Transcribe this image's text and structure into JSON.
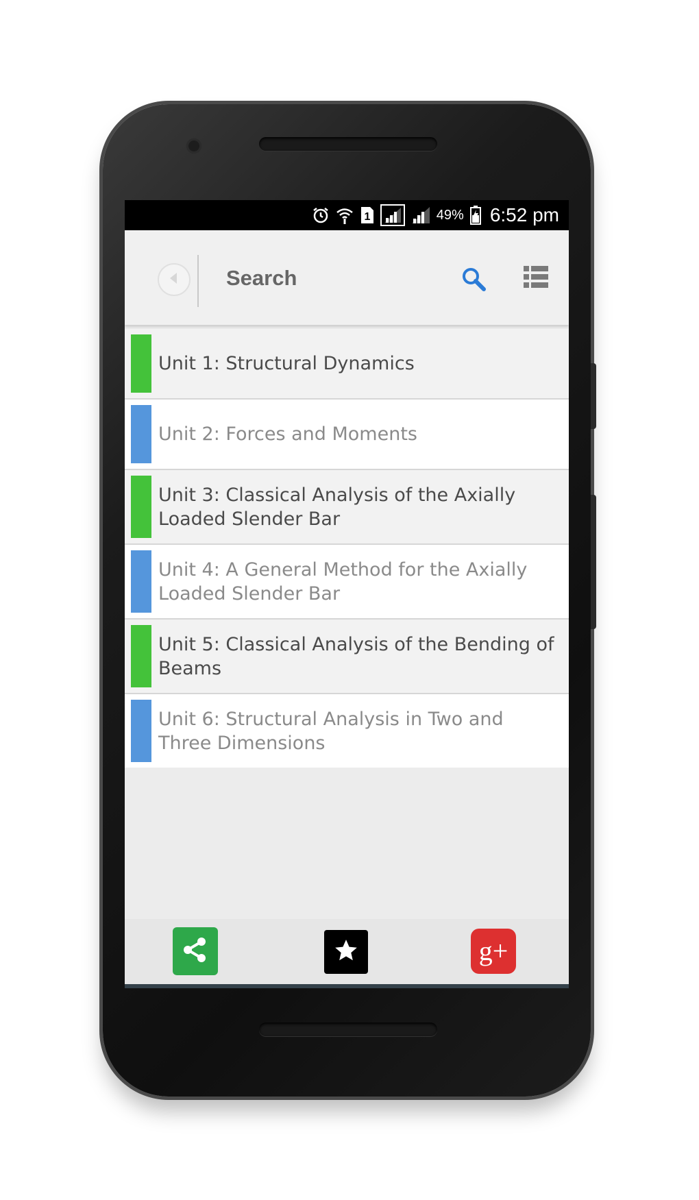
{
  "status_bar": {
    "battery_percent": "49%",
    "time": "6:52 pm",
    "sim_label": "1",
    "icons": [
      "alarm-icon",
      "wifi-icon",
      "sim-icon",
      "signal-icon",
      "signal-icon",
      "battery-icon"
    ]
  },
  "toolbar": {
    "title": "Search",
    "back_icon": "back-arrow-icon",
    "search_icon": "search-icon",
    "menu_icon": "list-menu-icon",
    "search_color": "#2b7bd6"
  },
  "units": [
    {
      "label": "Unit 1: Structural Dynamics",
      "color": "#44c23a"
    },
    {
      "label": "Unit 2: Forces and Moments",
      "color": "#5596dc"
    },
    {
      "label": "Unit 3: Classical Analysis of the Axially Loaded Slender Bar",
      "color": "#44c23a"
    },
    {
      "label": "Unit 4: A General Method for the Axially Loaded Slender Bar",
      "color": "#5596dc"
    },
    {
      "label": "Unit 5: Classical Analysis of the Bending of Beams",
      "color": "#44c23a"
    },
    {
      "label": "Unit 6: Structural Analysis in Two and Three Dimensions",
      "color": "#5596dc"
    }
  ],
  "bottom_bar": {
    "share": {
      "icon": "share-icon",
      "color": "#2ea84a"
    },
    "favorite": {
      "icon": "star-icon",
      "color": "#000000"
    },
    "google_plus": {
      "icon": "google-plus-icon",
      "text": "g+",
      "color": "#dd3030"
    }
  }
}
